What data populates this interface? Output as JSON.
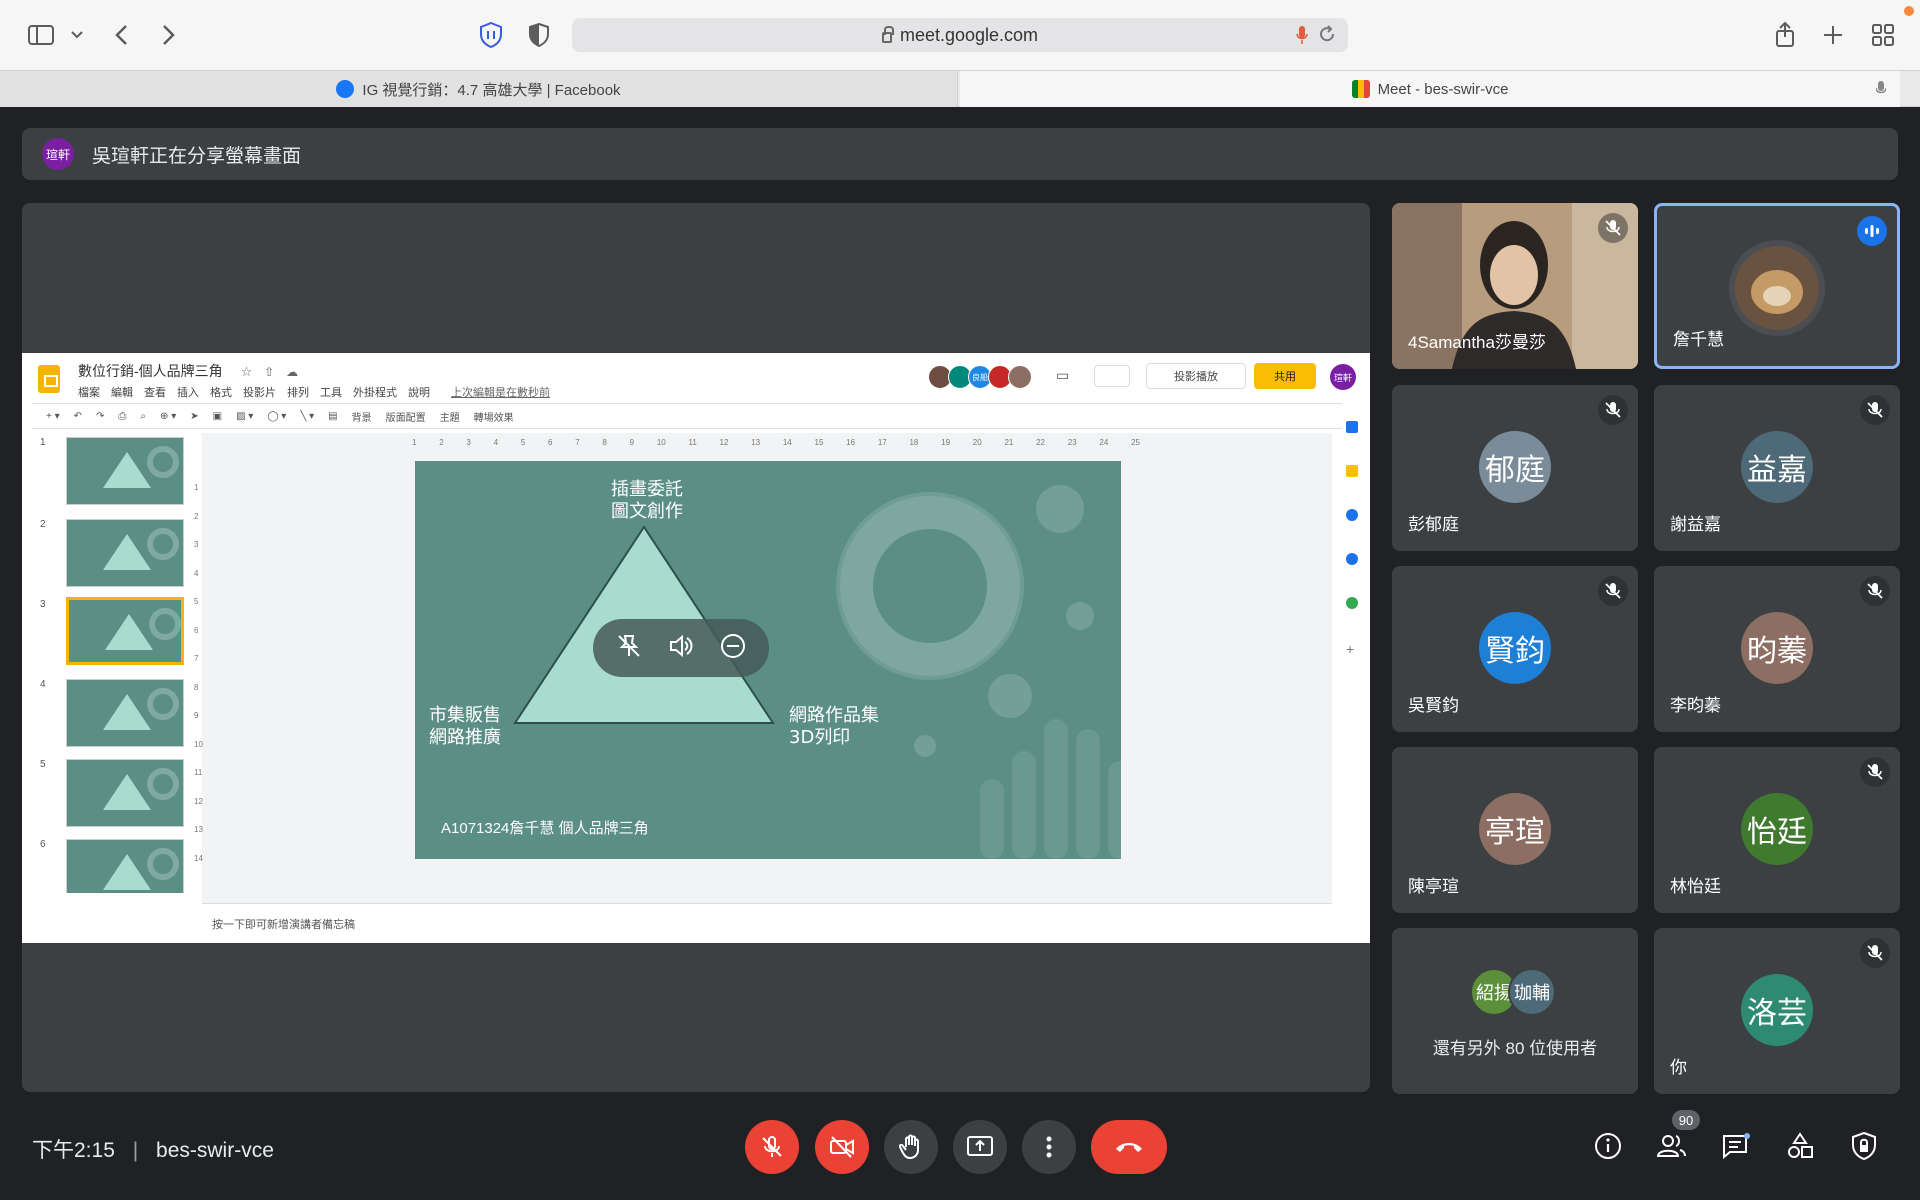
{
  "browser": {
    "address": "meet.google.com",
    "tabs": [
      {
        "label": "IG 視覺行銷：4.7 高雄大學 | Facebook"
      },
      {
        "label": "Meet - bes-swir-vce"
      }
    ]
  },
  "banner": {
    "avatar_text": "瑄軒",
    "text": "吳瑄軒正在分享螢幕畫面"
  },
  "slides_app": {
    "doc_title": "數位行銷-個人品牌三角",
    "menus": [
      "檔案",
      "編輯",
      "查看",
      "插入",
      "格式",
      "投影片",
      "排列",
      "工具",
      "外掛程式",
      "說明"
    ],
    "last_edit": "上次編輯是在數秒前",
    "collab_text": "良船",
    "present_label": "投影播放",
    "share_label": "共用",
    "user_initials": "瑄軒",
    "toolbar_labels": [
      "背景",
      "版面配置",
      "主題",
      "轉場效果"
    ],
    "thumb_numbers": [
      "1",
      "2",
      "3",
      "4",
      "5",
      "6"
    ],
    "ruler_top": [
      "1",
      "2",
      "3",
      "4",
      "5",
      "6",
      "7",
      "8",
      "9",
      "10",
      "11",
      "12",
      "13",
      "14",
      "15",
      "16",
      "17",
      "18",
      "19",
      "20",
      "21",
      "22",
      "23",
      "24",
      "25"
    ],
    "ruler_left": [
      "1",
      "2",
      "3",
      "4",
      "5",
      "6",
      "7",
      "8",
      "9",
      "10",
      "11",
      "12",
      "13",
      "14"
    ],
    "slide": {
      "top_text_1": "插畫委託",
      "top_text_2": "圖文創作",
      "left_text_1": "市集販售",
      "left_text_2": "網路推廣",
      "right_text_1": "網路作品集",
      "right_text_2": "3D列印",
      "caption": "A1071324詹千慧   個人品牌三角"
    },
    "notes_placeholder": "按一下即可新增演講者備忘稿"
  },
  "participants": [
    {
      "name": "4Samantha莎曼莎",
      "type": "video",
      "muted": true
    },
    {
      "name": "詹千慧",
      "type": "photo",
      "speaking": true
    },
    {
      "name": "彭郁庭",
      "initials": "郁庭",
      "color": "#7a8c99",
      "muted": true
    },
    {
      "name": "謝益嘉",
      "initials": "益嘉",
      "color": "#4e6a78",
      "muted": true
    },
    {
      "name": "吳賢鈞",
      "initials": "賢鈞",
      "color": "#1e7fd6",
      "muted": true
    },
    {
      "name": "李昀蓁",
      "initials": "昀蓁",
      "color": "#8d6e63",
      "muted": true
    },
    {
      "name": "陳亭瑄",
      "initials": "亭瑄",
      "color": "#8d6e63",
      "muted": false
    },
    {
      "name": "林怡廷",
      "initials": "怡廷",
      "color": "#3f7a2e",
      "muted": true
    },
    {
      "name": "還有另外 80 位使用者",
      "initials_a": "紹揚",
      "initials_b": "珈輔"
    },
    {
      "name": "你",
      "initials": "洛芸",
      "color": "#2e8b72",
      "muted": true
    }
  ],
  "bottom_bar": {
    "time": "下午2:15",
    "meeting_code": "bes-swir-vce",
    "people_count": "90"
  }
}
